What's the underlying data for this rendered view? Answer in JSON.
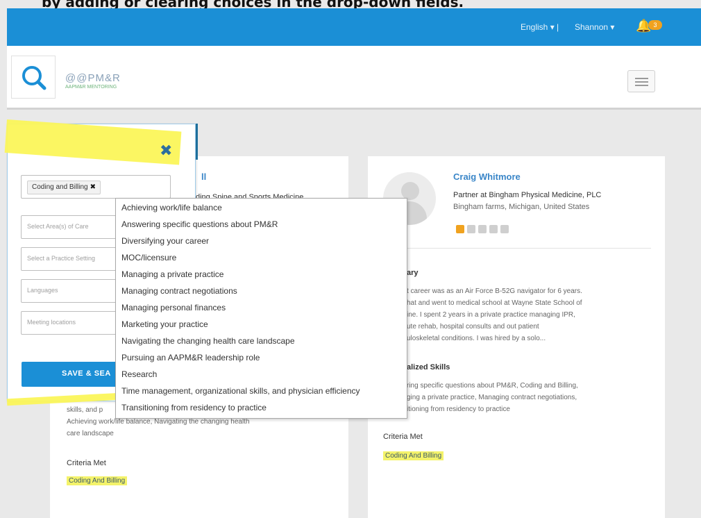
{
  "caption": "by adding or clearing choices in the drop-down fields.",
  "topbar": {
    "language": "English ▾ |",
    "user": "Shannon ▾",
    "notification_count": "3",
    "bell_icon": "bell-icon",
    "color": "#1b8fd6"
  },
  "header": {
    "logo_text": "@@PM&R",
    "logo_subtext": "AAPM&R MENTORING",
    "search_icon": "search-icon",
    "menu_icon": "hamburger-icon"
  },
  "filter": {
    "selected_chip": "Coding and Billing",
    "chip_remove": "✖",
    "area_of_care_placeholder": "Select Area(s) of Care",
    "practice_setting_placeholder": "Select a Practice Setting",
    "languages_placeholder": "Languages",
    "meeting_locations_placeholder": "Meeting locations",
    "save_label": "SAVE & SEA",
    "close_icon": "close-icon",
    "dropdown_options": [
      "Achieving work/life balance",
      "Answering specific questions about PM&R",
      "Diversifying your career",
      "MOC/licensure",
      "Managing a private practice",
      "Managing contract negotiations",
      "Managing personal finances",
      "Marketing your practice",
      "Navigating the changing health care landscape",
      "Pursuing an AAPM&R leadership role",
      "Research",
      "Time management, organizational skills, and physician efficiency",
      "Transitioning from residency to practice"
    ]
  },
  "left_card": {
    "name_partial": "ll",
    "subtitle_partial": "ding Spine and Sports Medicine",
    "skills_line_1": "skills, and p",
    "skills_line_2": "Achieving work/life balance, Navigating the changing health",
    "skills_line_3": "care landscape",
    "criteria_title": "Criteria Met",
    "criteria_value": "Coding And Billing"
  },
  "right_card": {
    "name": "Craig Whitmore",
    "title": "Partner at Bingham Physical Medicine, PLC",
    "location": "Bingham farms, Michigan, United States",
    "rating": 1,
    "rating_max": 5,
    "summary_title": "ary",
    "summary_lines": [
      "t career was as an Air Force B-52G navigator for 6 years.",
      "hat and went to medical school at Wayne State School of",
      "ine. I spent 2 years in a private practice managing IPR,",
      "ute rehab, hospital consults and out patient",
      "uloskeletal conditions. I was hired by a solo..."
    ],
    "skills_title": "alized Skills",
    "skills_lines": [
      "ring specific questions about PM&R, Coding and Billing,",
      "ging a private practice, Managing contract negotiations,",
      "itioning from residency to practice"
    ],
    "criteria_title": "Criteria Met",
    "criteria_value": "Coding And Billing"
  }
}
